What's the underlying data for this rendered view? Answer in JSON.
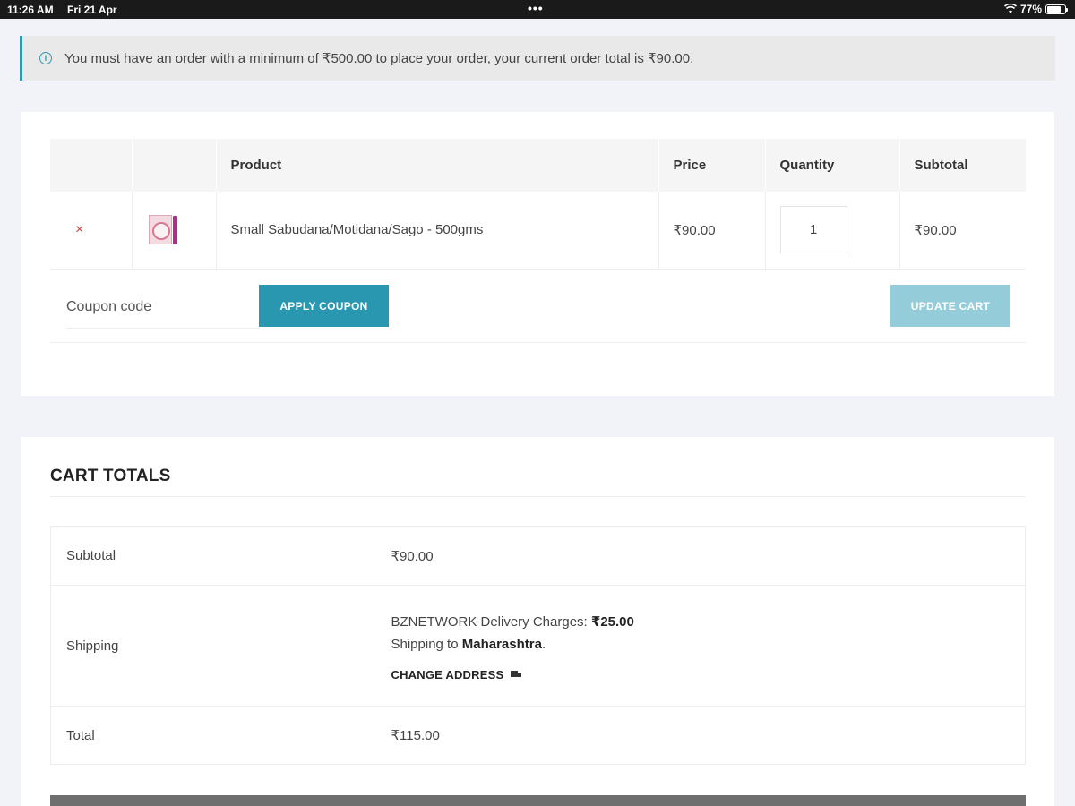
{
  "status_bar": {
    "time": "11:26 AM",
    "date": "Fri 21 Apr",
    "dots": "•••",
    "battery": "77%",
    "battery_level": 0.77
  },
  "notice": {
    "icon": "info-icon",
    "text": "You must have an order with a minimum of ₹500.00 to place your order, your current order total is ₹90.00."
  },
  "cart": {
    "headers": {
      "product": "Product",
      "price": "Price",
      "quantity": "Quantity",
      "subtotal": "Subtotal"
    },
    "items": [
      {
        "remove": "×",
        "thumbnail_icon": "product-thumbnail",
        "name": "Small Sabudana/Motidana/Sago - 500gms",
        "price": "₹90.00",
        "quantity": "1",
        "subtotal": "₹90.00"
      }
    ],
    "coupon_placeholder": "Coupon code",
    "apply_coupon_label": "APPLY COUPON",
    "update_cart_label": "UPDATE CART"
  },
  "totals": {
    "title": "CART TOTALS",
    "subtotal_label": "Subtotal",
    "subtotal_value": "₹90.00",
    "shipping_label": "Shipping",
    "shipping_method": "BZNETWORK Delivery Charges:",
    "shipping_cost": "₹25.00",
    "shipping_to_prefix": "Shipping to",
    "shipping_region": "Maharashtra",
    "shipping_to_suffix": ".",
    "change_address_label": "CHANGE ADDRESS",
    "change_address_icon": "truck-icon",
    "total_label": "Total",
    "total_value": "₹115.00"
  },
  "colors": {
    "accent": "#2a97b0",
    "accent_disabled": "#94cdd9",
    "remove": "#e03a3a",
    "page_bg": "#f2f3f8"
  }
}
